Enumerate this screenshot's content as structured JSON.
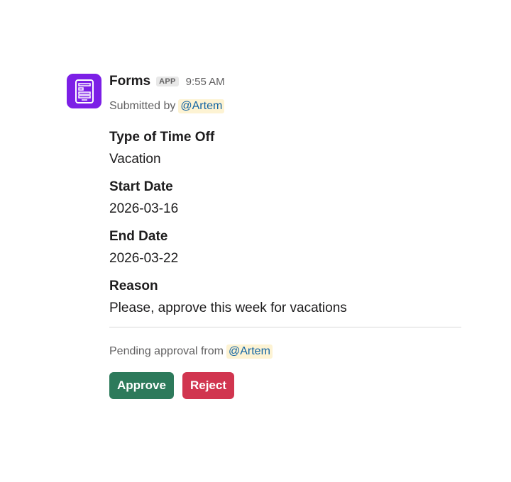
{
  "message": {
    "app_name": "Forms",
    "app_badge": "APP",
    "timestamp": "9:55 AM",
    "submitted_by_prefix": "Submitted by",
    "submitted_by_user": "@Artem",
    "avatar_icon": "form-document-icon",
    "avatar_color": "#7c1fe6"
  },
  "fields": [
    {
      "label": "Type of Time Off",
      "value": "Vacation"
    },
    {
      "label": "Start Date",
      "value": "2026-03-16"
    },
    {
      "label": "End Date",
      "value": "2026-03-22"
    },
    {
      "label": "Reason",
      "value": "Please, approve this week for vacations"
    }
  ],
  "approval": {
    "pending_prefix": "Pending approval from",
    "approver": "@Artem"
  },
  "actions": {
    "approve_label": "Approve",
    "reject_label": "Reject",
    "approve_color": "#2d7a5b",
    "reject_color": "#d1354f"
  }
}
